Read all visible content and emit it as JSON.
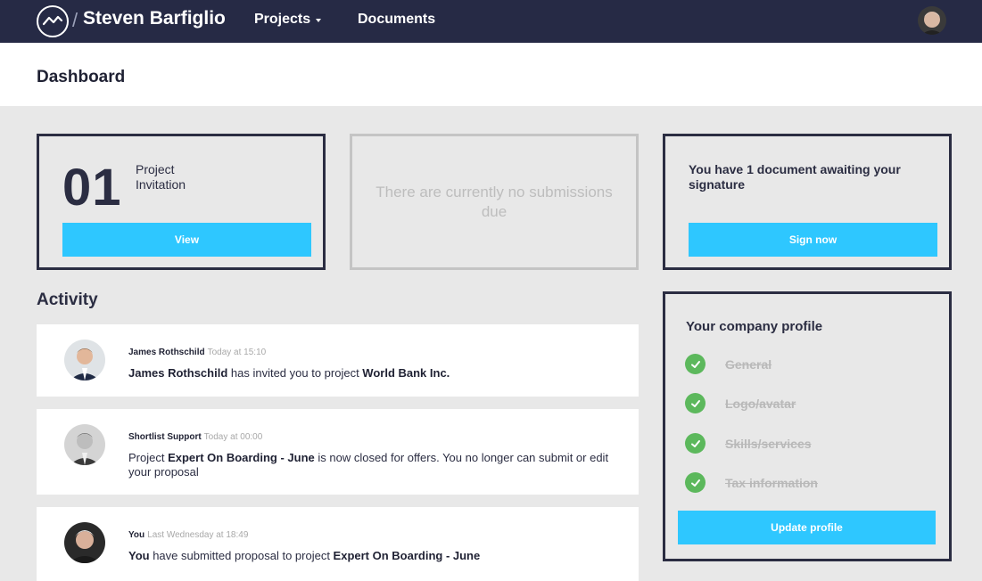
{
  "nav": {
    "separator": "/",
    "user_name": "Steven Barfiglio",
    "projects_label": "Projects",
    "documents_label": "Documents"
  },
  "page": {
    "title": "Dashboard"
  },
  "invitation": {
    "count": "01",
    "label": "Project Invitation",
    "button": "View"
  },
  "submissions": {
    "empty_text": "There are currently no submissions due"
  },
  "signature": {
    "text": "You have 1 document awaiting your signature",
    "button": "Sign now"
  },
  "activity": {
    "title": "Activity",
    "items": [
      {
        "name": "James Rothschild",
        "time": "Today at 15:10",
        "body": [
          {
            "t": "James Rothschild",
            "b": true
          },
          {
            "t": " has invited you to project ",
            "b": false
          },
          {
            "t": "World Bank Inc.",
            "b": true
          }
        ]
      },
      {
        "name": "Shortlist Support",
        "time": "Today at 00:00",
        "body": [
          {
            "t": "Project ",
            "b": false
          },
          {
            "t": "Expert On Boarding - June",
            "b": true
          },
          {
            "t": " is now closed for offers. You no longer can submit or edit your proposal",
            "b": false
          }
        ]
      },
      {
        "name": "You",
        "time": "Last Wednesday at 18:49",
        "body": [
          {
            "t": "You",
            "b": true
          },
          {
            "t": " have submitted proposal to project ",
            "b": false
          },
          {
            "t": "Expert On Boarding - June",
            "b": true
          }
        ]
      }
    ]
  },
  "profile": {
    "title": "Your company profile",
    "items": [
      "General",
      "Logo/avatar",
      "Skills/services",
      "Tax information"
    ],
    "button": "Update profile"
  },
  "colors": {
    "nav": "#262a45",
    "accent": "#2ec7ff",
    "check": "#5cb85c"
  }
}
